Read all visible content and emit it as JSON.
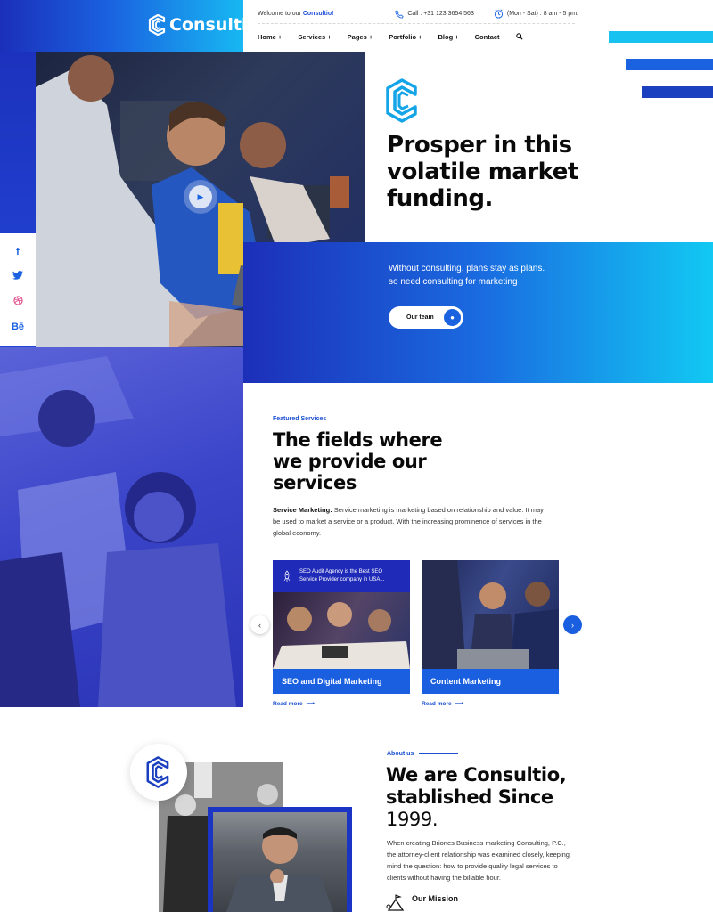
{
  "brand": {
    "name": "Consultio",
    "accent": "#1a5fe0",
    "accent_dark": "#1b2fb9",
    "accent_light": "#12c9f3"
  },
  "topbar": {
    "welcome_prefix": "Welcome to our",
    "welcome_brand": "Consultio!",
    "phone_icon": "phone-icon",
    "phone": "Call : +31 123 3654 563",
    "clock_icon": "clock-icon",
    "hours": "(Mon - Sat) : 8 am - 5 pm."
  },
  "nav": {
    "items": [
      "Home +",
      "Services +",
      "Pages +",
      "Portfolio +",
      "Blog +",
      "Contact"
    ],
    "search_icon": "search-icon"
  },
  "social": [
    "f",
    "t",
    "dribbble",
    "Bē"
  ],
  "hero": {
    "title": "Prosper in this volatile market funding.",
    "subtitle_line1": "Without consulting, plans stay as plans.",
    "subtitle_line2": "so need consulting for marketing",
    "button": "Our team"
  },
  "services": {
    "tag": "Featured Services",
    "title": "The fields where we provide our services",
    "desc_label": "Service Marketing:",
    "desc": "Service marketing is marketing based on relationship and value. It may be used to market a service or a product. With the increasing prominence of services in the global economy.",
    "cards": [
      {
        "banner": "SEO Audit Agency is the Best SEO Service Provider company in USA...",
        "title": "SEO and Digital Marketing",
        "read_more": "Read more"
      },
      {
        "banner": "",
        "title": "Content Marketing",
        "read_more": "Read more"
      }
    ]
  },
  "about": {
    "tag": "About us",
    "title_line1": "We are Consultio,",
    "title_line2": "stablished Since",
    "year": "1999.",
    "desc": "When creating Briones Business marketing Consulting, P.C., the attorney-client relationship was examined closely, keeping mind the question: how to provide quality legal services to clients without having the billable hour.",
    "mission": "Our Mission"
  }
}
